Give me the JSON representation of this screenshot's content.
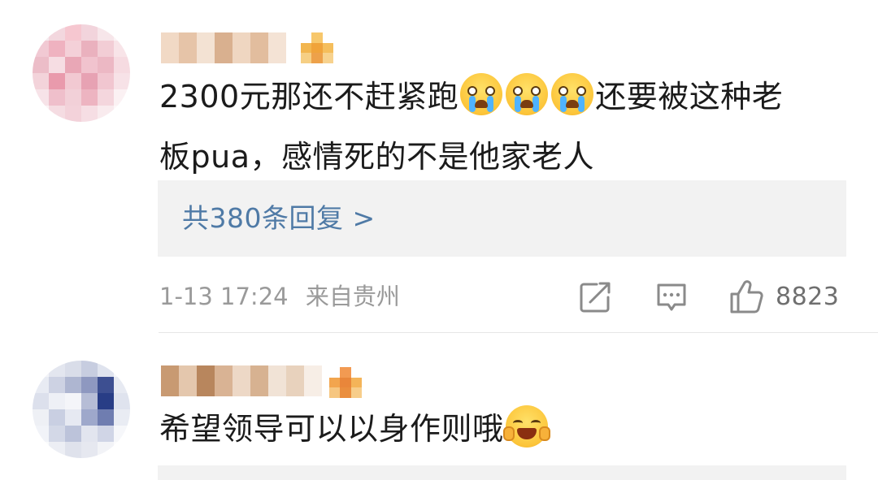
{
  "comments": [
    {
      "text_part1": "2300元那还不赶紧跑",
      "emoji_icons": [
        "crying-face-icon",
        "crying-face-icon",
        "crying-face-icon"
      ],
      "text_part2": "还要被这种老",
      "text_line2": "板pua，感情死的不是他家老人",
      "replies_label": "共380条回复 >",
      "date": "1-13 17:24",
      "location": "来自贵州",
      "likes": "8823"
    },
    {
      "text": "希望领导可以以身作则哦",
      "emoji_icon": "laughing-crying-face-icon"
    }
  ],
  "colors": {
    "link": "#4f7aa6",
    "meta": "#9a9a9a",
    "reply_bg": "#f2f2f2",
    "text": "#1b1b1b"
  }
}
